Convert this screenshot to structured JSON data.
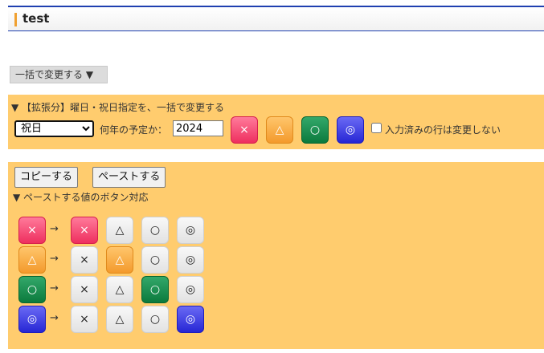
{
  "header": {
    "title": "test"
  },
  "bulk_toggle": {
    "label": "一括で変更する ▼"
  },
  "weekday_panel": {
    "heading": "▼ 【拡張分】曜日・祝日指定を、一括で変更する",
    "select_value": "祝日",
    "year_label": "何年の予定か：",
    "year_value": "2024",
    "buttons": [
      "×",
      "△",
      "○",
      "◎"
    ],
    "checkbox_label": "入力済みの行は変更しない"
  },
  "paste_panel": {
    "copy_label": "コピーする",
    "paste_label": "ペーストする",
    "subheading": "▼ ペーストする値のボタン対応",
    "arrow": "→",
    "rows": [
      {
        "source": "×",
        "targets": [
          "×",
          "△",
          "○",
          "◎"
        ],
        "selected": 0
      },
      {
        "source": "△",
        "targets": [
          "×",
          "△",
          "○",
          "◎"
        ],
        "selected": 1
      },
      {
        "source": "○",
        "targets": [
          "×",
          "△",
          "○",
          "◎"
        ],
        "selected": 2
      },
      {
        "source": "◎",
        "targets": [
          "×",
          "△",
          "○",
          "◎"
        ],
        "selected": 3
      }
    ]
  },
  "colors": {
    "panel": "#ffcc6e",
    "pink": "#ee2f5f",
    "orange": "#f39a2c",
    "green": "#0b7a3d",
    "blue": "#2626d4",
    "header_accent": "#f0a030"
  }
}
